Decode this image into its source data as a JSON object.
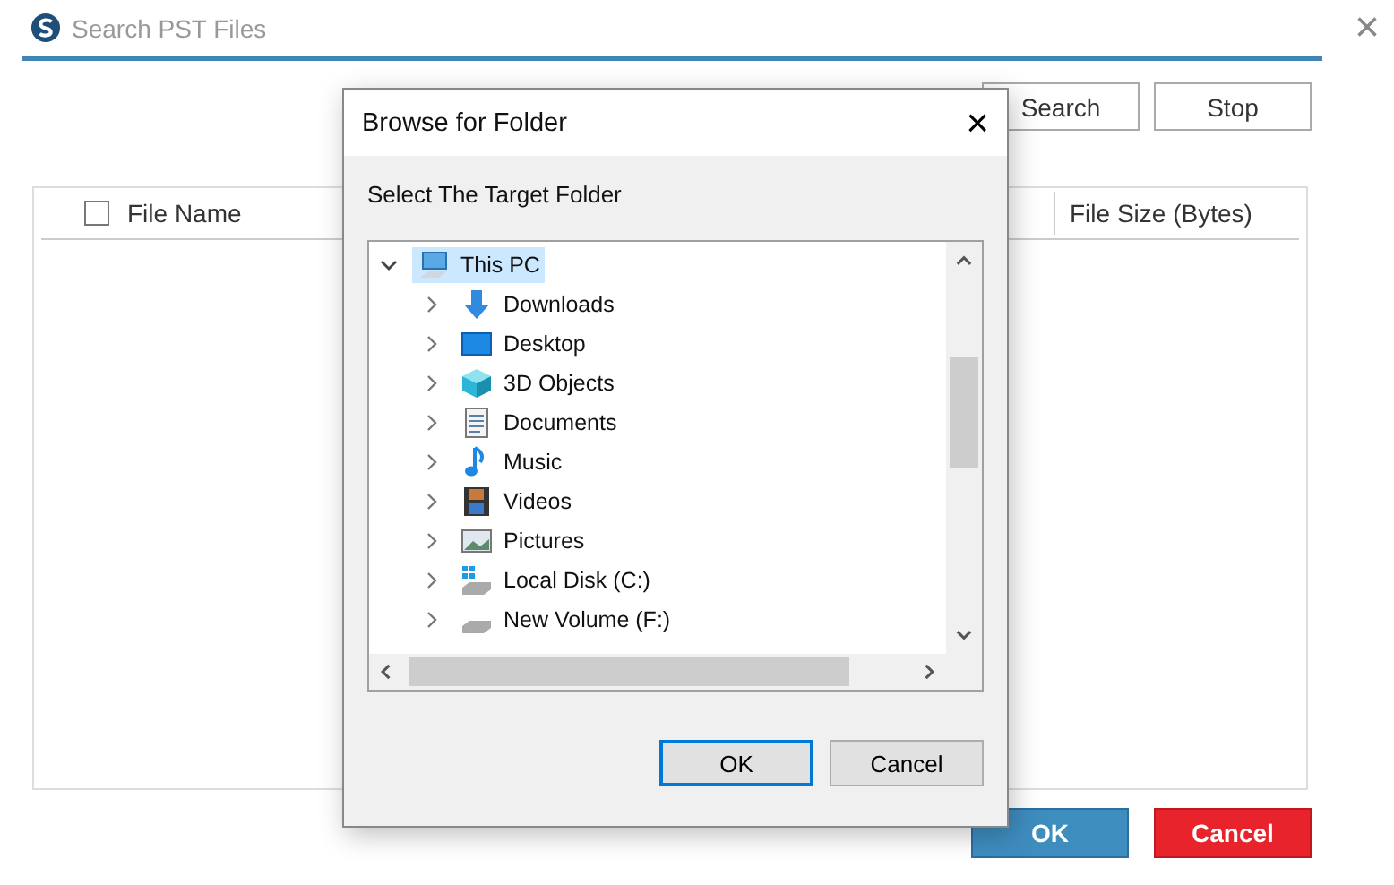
{
  "window": {
    "title": "Search PST Files",
    "close": "×"
  },
  "toolbar": {
    "buttons": [
      "Search",
      "Stop"
    ]
  },
  "table": {
    "select_all": {
      "checked": false
    },
    "columns": [
      "File Name",
      "File Size (Bytes)"
    ]
  },
  "footer": {
    "ok": "OK",
    "cancel": "Cancel"
  },
  "dialog": {
    "title": "Browse for Folder",
    "close": "×",
    "prompt": "Select The Target Folder",
    "tree": [
      {
        "label": "This PC",
        "expanded": true,
        "selected": true,
        "children": [
          {
            "label": "Downloads",
            "expanded": false,
            "selected": false
          },
          {
            "label": "Desktop",
            "expanded": false,
            "selected": false
          },
          {
            "label": "3D Objects",
            "expanded": false,
            "selected": false
          },
          {
            "label": "Documents",
            "expanded": false,
            "selected": false
          },
          {
            "label": "Music",
            "expanded": false,
            "selected": false
          },
          {
            "label": "Videos",
            "expanded": false,
            "selected": false
          },
          {
            "label": "Pictures",
            "expanded": false,
            "selected": false
          },
          {
            "label": "Local Disk (C:)",
            "expanded": false,
            "selected": false
          },
          {
            "label": "New Volume (F:)",
            "expanded": false,
            "selected": false
          }
        ]
      }
    ],
    "buttons": [
      "OK",
      "Cancel"
    ]
  }
}
